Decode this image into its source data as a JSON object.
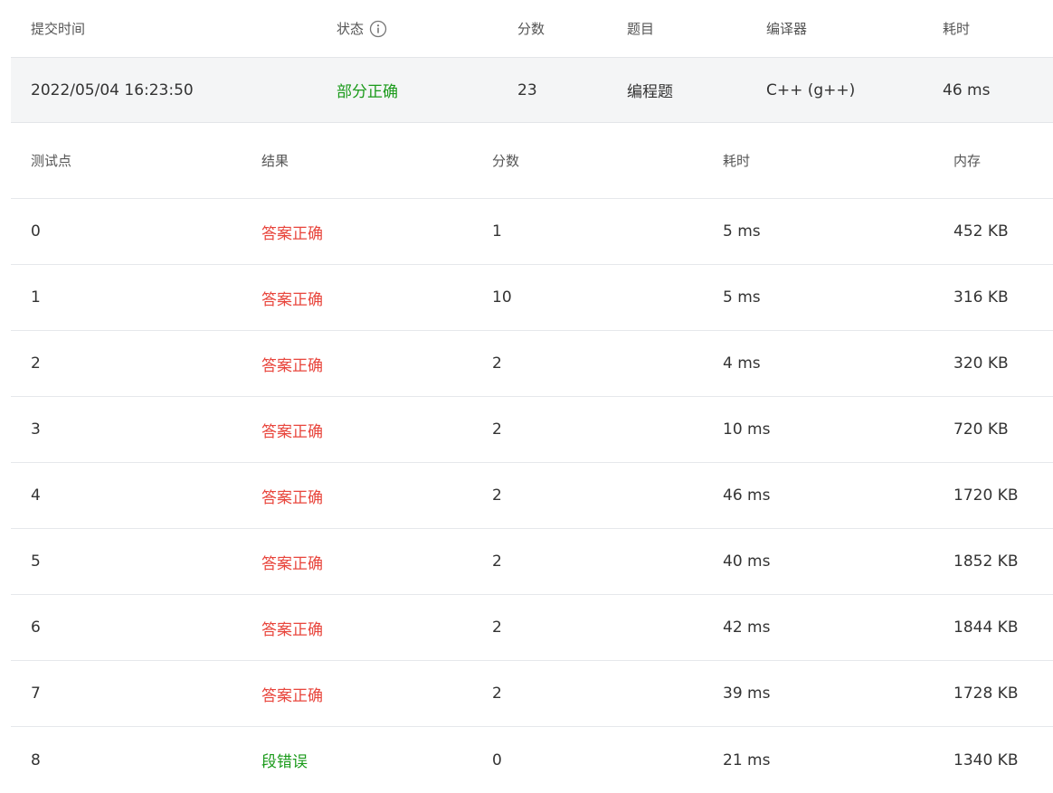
{
  "submission": {
    "headers": {
      "time": "提交时间",
      "status": "状态",
      "score": "分数",
      "problem": "题目",
      "compiler": "编译器",
      "duration": "耗时"
    },
    "status_icon": "info-icon",
    "row": {
      "time": "2022/05/04 16:23:50",
      "status": "部分正确",
      "score": "23",
      "problem": "编程题",
      "compiler": "C++ (g++)",
      "duration": "46 ms"
    }
  },
  "testcases": {
    "headers": {
      "point": "测试点",
      "result": "结果",
      "score": "分数",
      "duration": "耗时",
      "memory": "内存"
    },
    "rows": [
      {
        "point": "0",
        "result": "答案正确",
        "score": "1",
        "duration": "5 ms",
        "memory": "452 KB"
      },
      {
        "point": "1",
        "result": "答案正确",
        "score": "10",
        "duration": "5 ms",
        "memory": "316 KB"
      },
      {
        "point": "2",
        "result": "答案正确",
        "score": "2",
        "duration": "4 ms",
        "memory": "320 KB"
      },
      {
        "point": "3",
        "result": "答案正确",
        "score": "2",
        "duration": "10 ms",
        "memory": "720 KB"
      },
      {
        "point": "4",
        "result": "答案正确",
        "score": "2",
        "duration": "46 ms",
        "memory": "1720 KB"
      },
      {
        "point": "5",
        "result": "答案正确",
        "score": "2",
        "duration": "40 ms",
        "memory": "1852 KB"
      },
      {
        "point": "6",
        "result": "答案正确",
        "score": "2",
        "duration": "42 ms",
        "memory": "1844 KB"
      },
      {
        "point": "7",
        "result": "答案正确",
        "score": "2",
        "duration": "39 ms",
        "memory": "1728 KB"
      },
      {
        "point": "8",
        "result": "段错误",
        "score": "0",
        "duration": "21 ms",
        "memory": "1340 KB"
      }
    ]
  },
  "colors": {
    "accepted": "#e8453c",
    "partial": "#1a9a1a",
    "segfault": "#1a9a1a",
    "row_background": "#f4f5f6"
  }
}
